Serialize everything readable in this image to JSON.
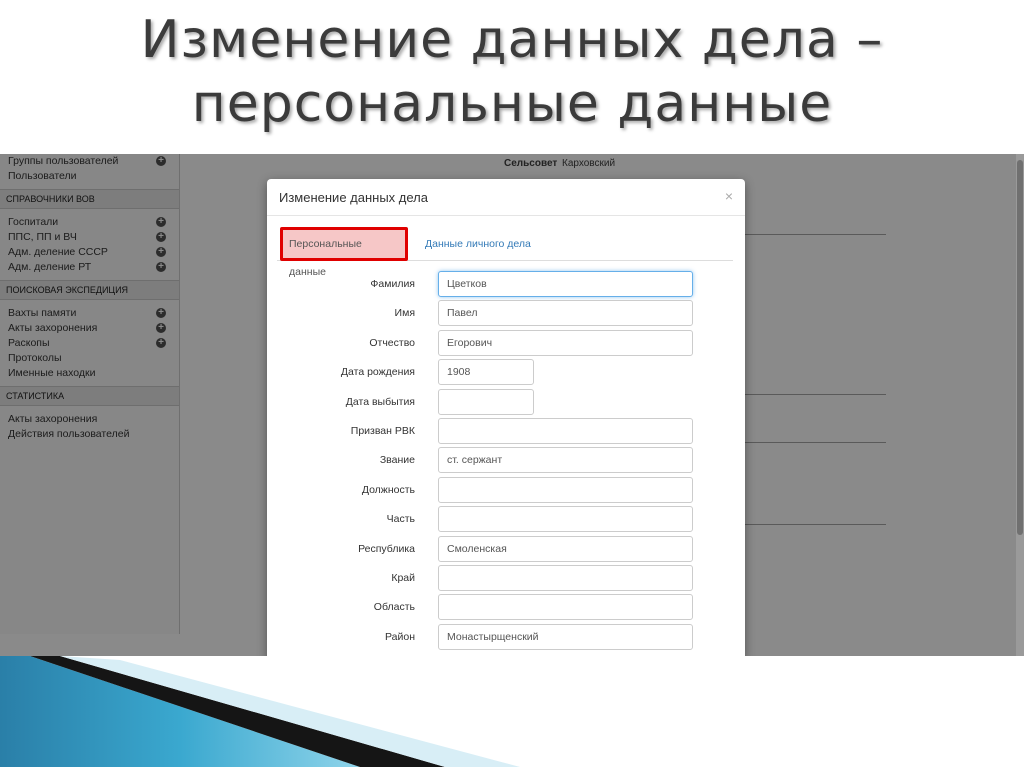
{
  "slide": {
    "title_line1": "Изменение данных дела –",
    "title_line2": "персональные данные"
  },
  "sidebar": {
    "top_items": [
      {
        "label": "Группы пользователей",
        "has_plus": true
      },
      {
        "label": "Пользователи",
        "has_plus": false
      }
    ],
    "sections": [
      {
        "header": "СПРАВОЧНИКИ ВОВ",
        "items": [
          {
            "label": "Госпитали",
            "has_plus": true
          },
          {
            "label": "ППС, ПП и ВЧ",
            "has_plus": true
          },
          {
            "label": "Адм. деление СССР",
            "has_plus": true
          },
          {
            "label": "Адм. деление РТ",
            "has_plus": true
          }
        ]
      },
      {
        "header": "ПОИСКОВАЯ ЭКСПЕДИЦИЯ",
        "items": [
          {
            "label": "Вахты памяти",
            "has_plus": true
          },
          {
            "label": "Акты захоронения",
            "has_plus": true
          },
          {
            "label": "Раскопы",
            "has_plus": true
          },
          {
            "label": "Протоколы",
            "has_plus": false
          },
          {
            "label": "Именные находки",
            "has_plus": false
          }
        ]
      },
      {
        "header": "СТАТИСТИКА",
        "items": [
          {
            "label": "Акты захоронения",
            "has_plus": false
          },
          {
            "label": "Действия пользователей",
            "has_plus": false
          }
        ]
      }
    ],
    "plus_icon": "plus-circle-icon"
  },
  "background": {
    "field_label": "Сельсовет",
    "field_value": "Карховский"
  },
  "modal": {
    "title": "Изменение данных дела",
    "close_symbol": "×",
    "tabs": [
      {
        "label": "Персональные данные",
        "active": true
      },
      {
        "label": "Данные личного дела",
        "active": false
      }
    ],
    "fields": [
      {
        "label": "Фамилия",
        "value": "Цветков",
        "size": "wide",
        "focused": true
      },
      {
        "label": "Имя",
        "value": "Павел",
        "size": "wide",
        "focused": false
      },
      {
        "label": "Отчество",
        "value": "Егорович",
        "size": "wide",
        "focused": false
      },
      {
        "label": "Дата рождения",
        "value": "1908",
        "size": "short",
        "focused": false
      },
      {
        "label": "Дата выбытия",
        "value": "",
        "size": "short",
        "focused": false
      },
      {
        "label": "Призван РВК",
        "value": "",
        "size": "wide",
        "focused": false
      },
      {
        "label": "Звание",
        "value": "ст. сержант",
        "size": "wide",
        "focused": false
      },
      {
        "label": "Должность",
        "value": "",
        "size": "wide",
        "focused": false
      },
      {
        "label": "Часть",
        "value": "",
        "size": "wide",
        "focused": false
      },
      {
        "label": "Республика",
        "value": "Смоленская",
        "size": "wide",
        "focused": false
      },
      {
        "label": "Край",
        "value": "",
        "size": "wide",
        "focused": false
      },
      {
        "label": "Область",
        "value": "",
        "size": "wide",
        "focused": false
      },
      {
        "label": "Район",
        "value": "Монастырщенский",
        "size": "wide",
        "focused": false
      }
    ]
  },
  "colors": {
    "active_tab_border": "#e00000",
    "active_tab_fill": "#f6c7c7",
    "link": "#337ab7",
    "band_blue": "#2a9bc1",
    "band_dark": "#1a1a1a"
  }
}
